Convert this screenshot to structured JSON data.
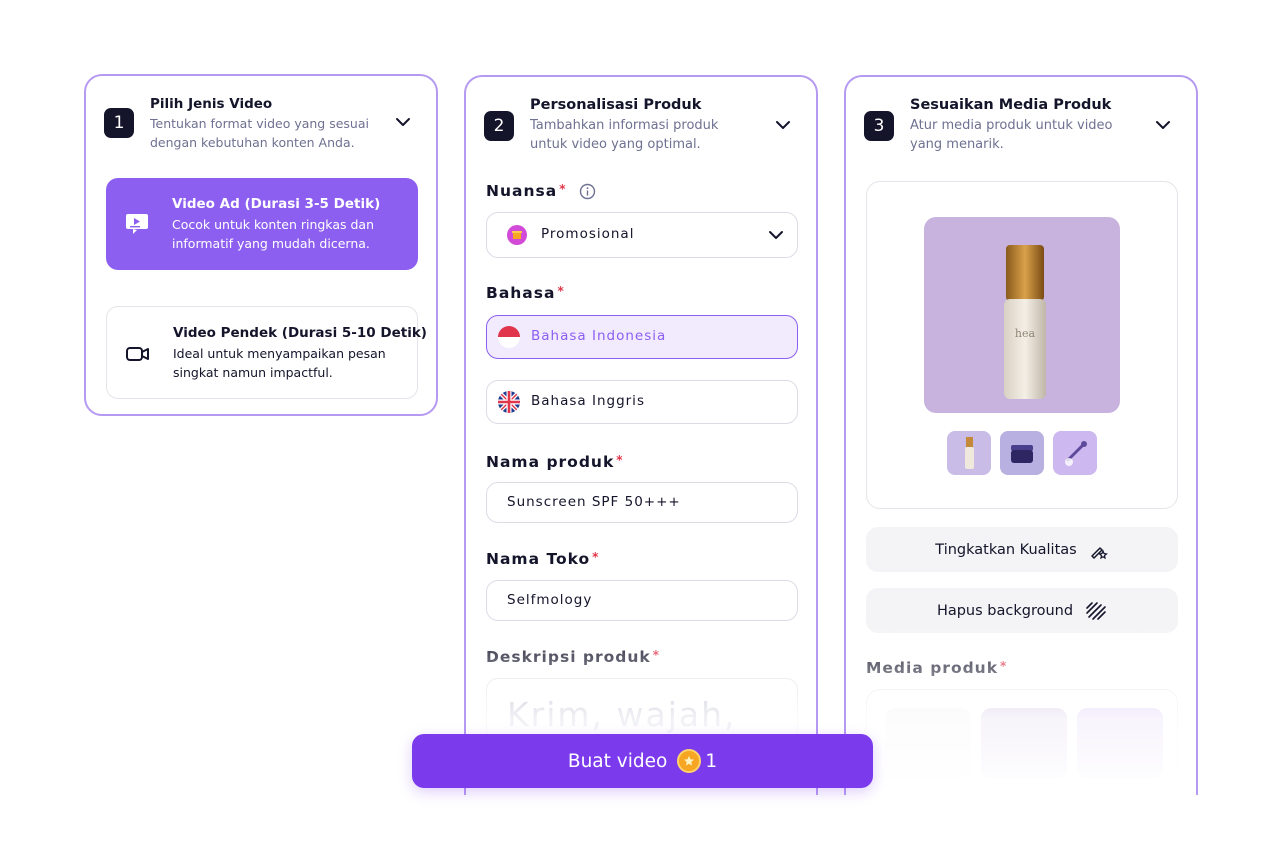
{
  "step1": {
    "number": "1",
    "title": "Pilih Jenis Video",
    "subtitle": "Tentukan format video yang sesuai dengan kebutuhan konten Anda.",
    "options": [
      {
        "title": "Video Ad (Durasi 3-5 Detik)",
        "description": "Cocok untuk konten ringkas dan informatif yang mudah dicerna.",
        "icon": "video-ad-icon",
        "selected": true
      },
      {
        "title": "Video Pendek (Durasi 5-10 Detik)",
        "description": "Ideal untuk menyampaikan pesan singkat namun impactful.",
        "icon": "video-camera-icon",
        "selected": false
      }
    ]
  },
  "step2": {
    "number": "2",
    "title": "Personalisasi Produk",
    "subtitle": "Tambahkan informasi produk untuk video yang optimal.",
    "nuansa_label": "Nuansa",
    "nuansa_value": "Promosional",
    "bahasa_label": "Bahasa",
    "languages": [
      {
        "label": "Bahasa Indonesia",
        "selected": true
      },
      {
        "label": "Bahasa Inggris",
        "selected": false
      }
    ],
    "nama_produk_label": "Nama produk",
    "nama_produk_value": "Sunscreen SPF 50+++",
    "nama_toko_label": "Nama Toko",
    "nama_toko_value": "Selfmology",
    "deskripsi_label": "Deskripsi produk",
    "deskripsi_placeholder": "Krim, wajah,",
    "required_mark": "*"
  },
  "step3": {
    "number": "3",
    "title": "Sesuaikan Media Produk",
    "subtitle": "Atur media produk untuk video yang menarik.",
    "enhance_label": "Tingkatkan Kualitas",
    "remove_bg_label": "Hapus background",
    "media_label": "Media produk"
  },
  "cta": {
    "label": "Buat video",
    "count": "1"
  },
  "colors": {
    "accent": "#8c5ff0",
    "cta": "#7c3aed",
    "border": "#b69af2",
    "required": "#e0354a"
  }
}
